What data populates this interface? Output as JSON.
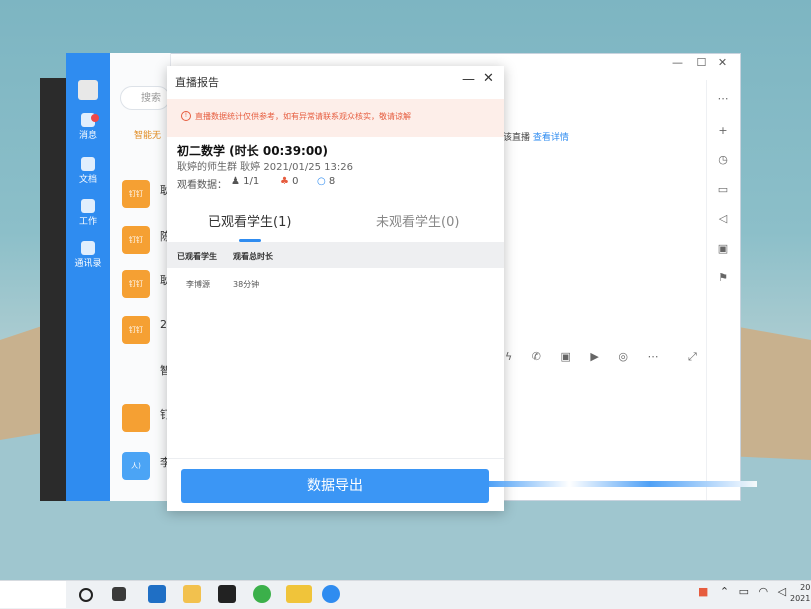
{
  "sidebar": {
    "items": [
      {
        "label": "消息",
        "badge": "1"
      },
      {
        "label": "文档"
      },
      {
        "label": "工作"
      },
      {
        "label": "通讯录"
      }
    ]
  },
  "chat_list": {
    "search_placeholder": "搜索",
    "section_label": "智能无",
    "items": [
      {
        "title": "耿",
        "thumb": "钉钉"
      },
      {
        "title": "陈",
        "thumb": "钉钉"
      },
      {
        "title": "耿",
        "thumb": "钉钉"
      },
      {
        "title": "2",
        "thumb": "钉钉"
      },
      {
        "title": "智"
      },
      {
        "title": "钉"
      },
      {
        "title": "李",
        "thumb": "人)"
      }
    ]
  },
  "right_panel": {
    "notice_text": "该直播",
    "notice_link": "查看详情"
  },
  "modal": {
    "title": "直播报告",
    "warning": "直播数据统计仅供参考，如有异常请联系观众核实，敬请谅解",
    "course_title": "初二数学 (时长 00:39:00)",
    "course_sub": "耿婷的师生群 耿婷 2021/01/25 13:26",
    "stats_label": "观看数据：",
    "stats": {
      "viewers": "1/1",
      "likes": "0",
      "comments": "8"
    },
    "tabs": {
      "watched": "已观看学生(1)",
      "unwatched": "未观看学生(0)"
    },
    "table": {
      "headers": [
        "已观看学生",
        "观看总时长"
      ],
      "rows": [
        [
          "李博源",
          "38分钟"
        ]
      ]
    },
    "export_label": "数据导出"
  },
  "taskbar": {
    "clock_time": "20",
    "clock_date": "2021"
  },
  "colors": {
    "accent": "#2f8cf0",
    "warning_bg": "#fdeee9",
    "warning_text": "#e65c3e",
    "button": "#3b96f5"
  }
}
